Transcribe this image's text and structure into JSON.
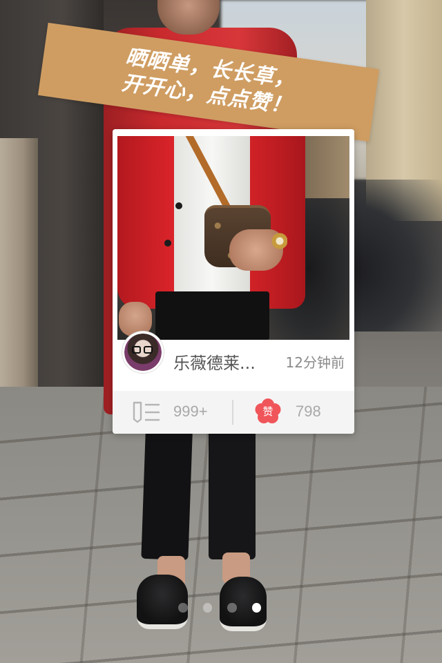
{
  "banner": {
    "line1": "晒晒单，长长草，",
    "line2": "开开心，点点赞！"
  },
  "post": {
    "username": "乐薇德莱...",
    "time_ago": "12分钟前",
    "comment_count": "999+",
    "like_icon_label": "赞",
    "like_count": "798",
    "comment_icon": "comment-list-icon",
    "like_icon": "flower-like-icon"
  },
  "pager": {
    "total": 4,
    "active_index": 3
  },
  "colors": {
    "banner": "#cf9d62",
    "like_icon": "#f0555a",
    "card_footer": "#f4f4f4"
  }
}
